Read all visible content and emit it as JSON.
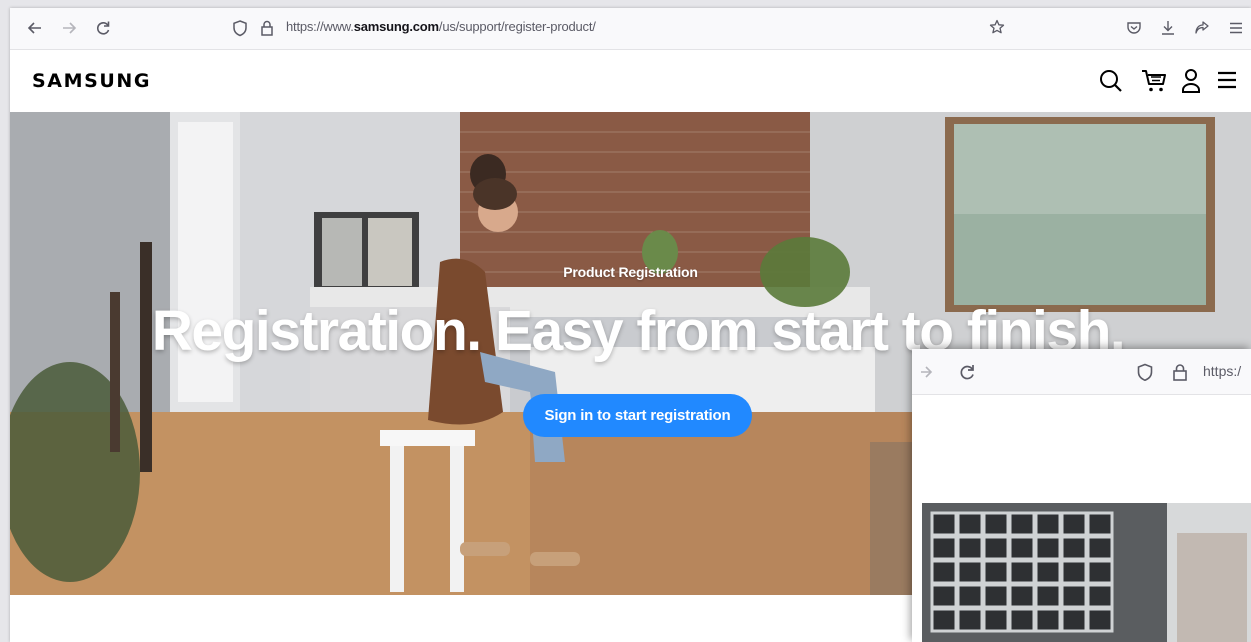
{
  "browser": {
    "url_prefix": "https://www.",
    "url_domain": "samsung.com",
    "url_path": "/us/support/register-product/",
    "icons": [
      "back-arrow-icon",
      "forward-arrow-icon",
      "reload-icon",
      "shield-icon",
      "lock-icon",
      "star-icon",
      "pocket-icon",
      "download-icon",
      "share-icon",
      "menu-icon"
    ]
  },
  "site": {
    "logo": "SAMSUNG",
    "icons": [
      "search-icon",
      "cart-icon",
      "account-icon",
      "hamburger-menu-icon"
    ]
  },
  "hero": {
    "eyebrow": "Product Registration",
    "title": "Registration. Easy from start to finish.",
    "cta_label": "Sign in to start registration"
  },
  "overlay_window": {
    "url_text": "https:/"
  },
  "colors": {
    "cta": "#2189ff",
    "toolbar": "#f9f9fb"
  }
}
